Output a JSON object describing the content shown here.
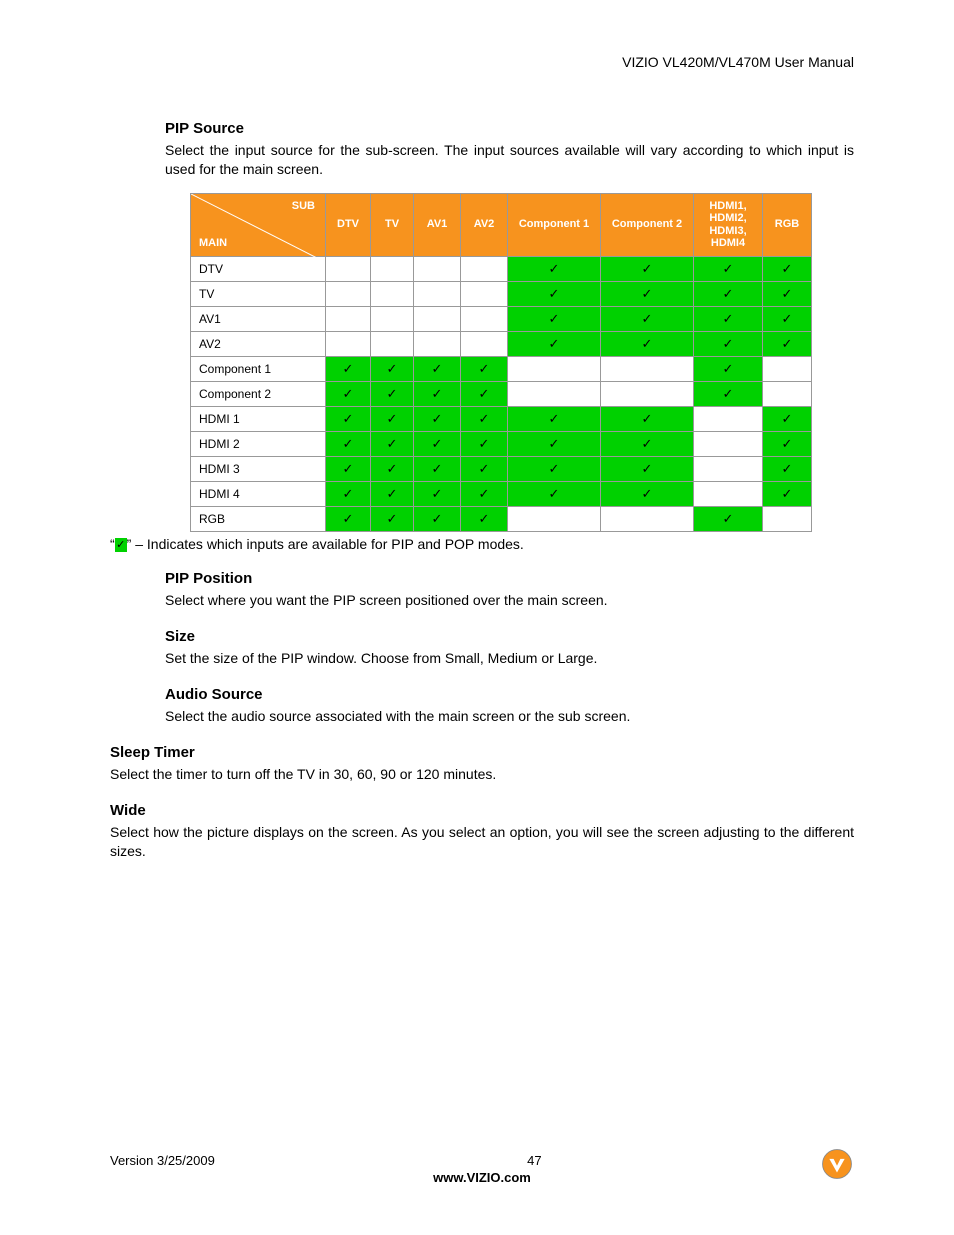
{
  "header": {
    "doc_title": "VIZIO VL420M/VL470M User Manual"
  },
  "sections": {
    "pip_source": {
      "heading": "PIP Source",
      "text": "Select the input source for the sub-screen. The input sources available will vary according to which input is used for the main screen."
    },
    "pip_position": {
      "heading": "PIP Position",
      "text": "Select where you want the PIP screen positioned over the main screen."
    },
    "size": {
      "heading": "Size",
      "text": "Set the size of the PIP window. Choose from Small, Medium or Large."
    },
    "audio_source": {
      "heading": "Audio Source",
      "text": "Select the audio source associated with the main screen or the sub screen."
    },
    "sleep_timer": {
      "heading": "Sleep Timer",
      "text": "Select the timer to turn off the TV in 30, 60, 90 or 120 minutes."
    },
    "wide": {
      "heading": "Wide",
      "text": "Select how the picture displays on the screen. As you select an option, you will see the screen adjusting to the different sizes."
    }
  },
  "legend": {
    "prefix": "“",
    "mark": "✓",
    "suffix": "” – Indicates which inputs are available for PIP and POP modes."
  },
  "table": {
    "corner_sub": "SUB",
    "corner_main": "MAIN",
    "cols": [
      "DTV",
      "TV",
      "AV1",
      "AV2",
      "Component 1",
      "Component 2",
      "HDMI1, HDMI2, HDMI3, HDMI4",
      "RGB"
    ],
    "rows": [
      {
        "label": "DTV",
        "cells": [
          0,
          0,
          0,
          0,
          1,
          1,
          1,
          1
        ]
      },
      {
        "label": "TV",
        "cells": [
          0,
          0,
          0,
          0,
          1,
          1,
          1,
          1
        ]
      },
      {
        "label": "AV1",
        "cells": [
          0,
          0,
          0,
          0,
          1,
          1,
          1,
          1
        ]
      },
      {
        "label": "AV2",
        "cells": [
          0,
          0,
          0,
          0,
          1,
          1,
          1,
          1
        ]
      },
      {
        "label": "Component 1",
        "cells": [
          1,
          1,
          1,
          1,
          0,
          0,
          1,
          0
        ]
      },
      {
        "label": "Component 2",
        "cells": [
          1,
          1,
          1,
          1,
          0,
          0,
          1,
          0
        ]
      },
      {
        "label": "HDMI 1",
        "cells": [
          1,
          1,
          1,
          1,
          1,
          1,
          0,
          1
        ]
      },
      {
        "label": "HDMI 2",
        "cells": [
          1,
          1,
          1,
          1,
          1,
          1,
          0,
          1
        ]
      },
      {
        "label": "HDMI 3",
        "cells": [
          1,
          1,
          1,
          1,
          1,
          1,
          0,
          1
        ]
      },
      {
        "label": "HDMI 4",
        "cells": [
          1,
          1,
          1,
          1,
          1,
          1,
          0,
          1
        ]
      },
      {
        "label": "RGB",
        "cells": [
          1,
          1,
          1,
          1,
          0,
          0,
          1,
          0
        ]
      }
    ],
    "check": "✓"
  },
  "footer": {
    "version": "Version 3/25/2009",
    "page": "47",
    "url": "www.VIZIO.com"
  }
}
